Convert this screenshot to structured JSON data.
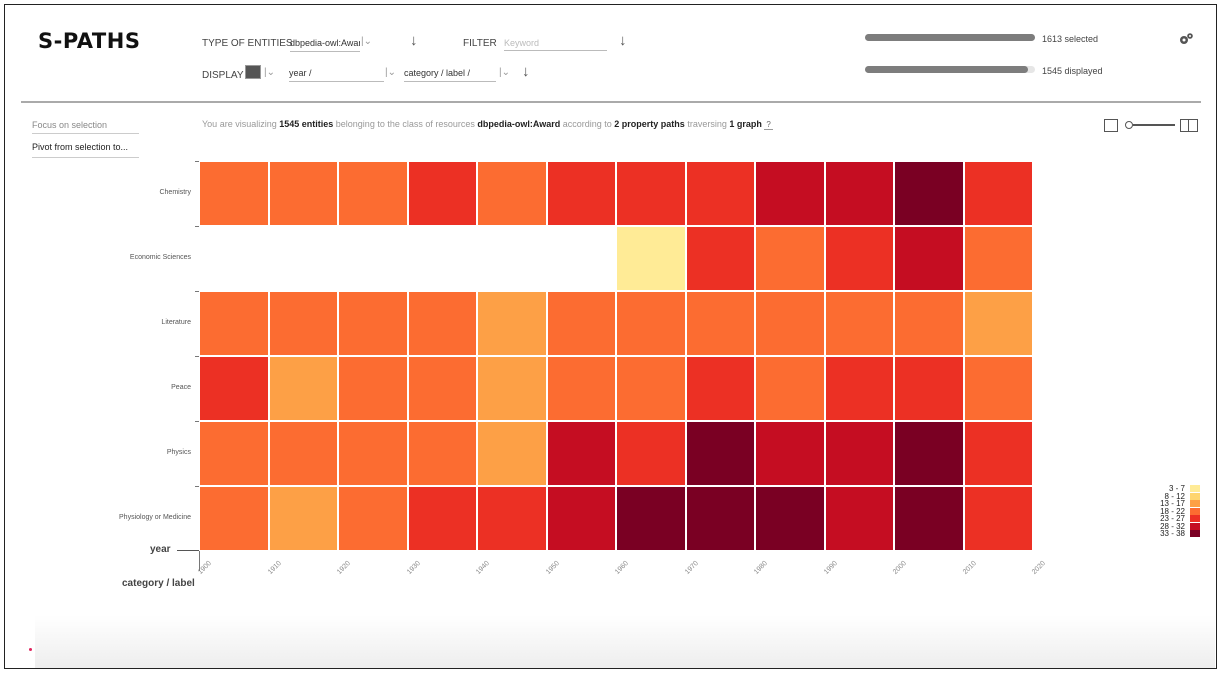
{
  "app": {
    "title": "S-PATHS"
  },
  "toolbar": {
    "type_label": "TYPE OF ENTITIES",
    "type_value": "dbpedia-owl:Award (16",
    "filter_label": "FILTER",
    "filter_placeholder": "Keyword",
    "display_label": "DISPLAY",
    "display_x": "year /",
    "display_y": "category / label /"
  },
  "stats": {
    "selected_text": "1613 selected",
    "displayed_text": "1545 displayed",
    "selected_fraction": 1.0,
    "displayed_fraction": 0.96
  },
  "sidebar": {
    "focus": "Focus on selection",
    "pivot": "Pivot from selection to..."
  },
  "info": {
    "p1": "You are visualizing",
    "count": "1545 entities",
    "p2": "belonging to the class of resources",
    "cls": "dbpedia-owl:Award",
    "p3": "according to",
    "paths": "2 property paths",
    "p4": "traversing",
    "graphs": "1 graph",
    "help": "?"
  },
  "chart_data": {
    "type": "heatmap",
    "x_axis_name": "year",
    "y_axis_name": "category / label",
    "x_ticks": [
      "1900",
      "1910",
      "1920",
      "1930",
      "1940",
      "1950",
      "1960",
      "1970",
      "1980",
      "1990",
      "2000",
      "2010",
      "2020"
    ],
    "rows": [
      "Chemistry",
      "Economic Sciences",
      "Literature",
      "Peace",
      "Physics",
      "Physiology or Medicine"
    ],
    "bins": [
      "1900-1910",
      "1910-1920",
      "1920-1930",
      "1930-1940",
      "1940-1950",
      "1950-1960",
      "1960-1970",
      "1970-1980",
      "1980-1990",
      "1990-2000",
      "2000-2010",
      "2010-2020"
    ],
    "values": [
      [
        20,
        20,
        20,
        25,
        20,
        25,
        25,
        25,
        30,
        30,
        35,
        25
      ],
      [
        null,
        null,
        null,
        null,
        null,
        null,
        5,
        25,
        20,
        25,
        30,
        20
      ],
      [
        20,
        20,
        20,
        20,
        15,
        20,
        20,
        20,
        20,
        20,
        20,
        15
      ],
      [
        25,
        15,
        20,
        20,
        15,
        20,
        20,
        25,
        20,
        25,
        25,
        20
      ],
      [
        20,
        20,
        20,
        20,
        15,
        30,
        25,
        35,
        30,
        30,
        35,
        25
      ],
      [
        20,
        15,
        20,
        25,
        25,
        30,
        35,
        35,
        35,
        30,
        35,
        25
      ]
    ],
    "legend": [
      {
        "label": "3 - 7",
        "color": "#ffeb96",
        "min": 3,
        "max": 7
      },
      {
        "label": "8 - 12",
        "color": "#fed56f",
        "min": 8,
        "max": 12
      },
      {
        "label": "13 - 17",
        "color": "#fda046",
        "min": 13,
        "max": 17
      },
      {
        "label": "18 - 22",
        "color": "#fc6c31",
        "min": 18,
        "max": 22
      },
      {
        "label": "23 - 27",
        "color": "#ec3024",
        "min": 23,
        "max": 27
      },
      {
        "label": "28 - 32",
        "color": "#c50d22",
        "min": 28,
        "max": 32
      },
      {
        "label": "33 - 38",
        "color": "#7a0023",
        "min": 33,
        "max": 38
      }
    ]
  },
  "icons": {
    "settings": "gears-icon",
    "view_single": "single-panel-icon",
    "view_split": "split-panel-icon",
    "download": "down-arrow-icon",
    "chart_type": "heatmap-type-icon"
  }
}
